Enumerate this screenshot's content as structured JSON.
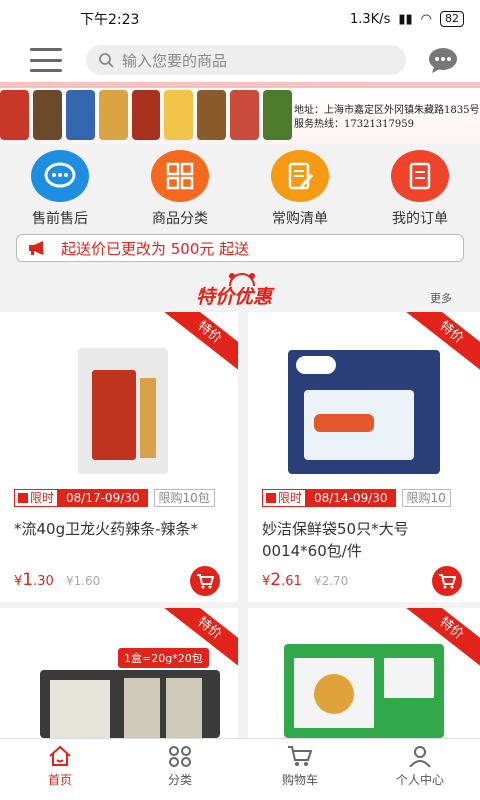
{
  "status": {
    "time": "下午2:23",
    "net": "1.3K/s",
    "battery": "82"
  },
  "header": {
    "search_placeholder": "输入您要的商品"
  },
  "banner": {
    "address_line": "地址：上海市嘉定区外冈镇朱藏路1835号",
    "hotline": "服务热线：17321317959"
  },
  "quick": [
    {
      "label": "售前售后",
      "color": "#1e8fe0"
    },
    {
      "label": "商品分类",
      "color": "#f56a1e"
    },
    {
      "label": "常购清单",
      "color": "#f59a12"
    },
    {
      "label": "我的订单",
      "color": "#f0442a"
    }
  ],
  "notice": {
    "text": "起送价已更改为  500元  起送"
  },
  "promo": {
    "title": "特价优惠",
    "more": "更多"
  },
  "products": [
    {
      "ribbon": "特价",
      "limit_label": "限时",
      "date": "08/17-09/30",
      "qty": "限购10包",
      "name": "*流40g卫龙火药辣条-辣条*",
      "currency": "¥",
      "price_int": "1",
      "price_dec": ".30",
      "old_price": "¥1.60"
    },
    {
      "ribbon": "特价",
      "limit_label": "限时",
      "date": "08/14-09/30",
      "qty": "限购10",
      "name": "妙洁保鲜袋50只*大号0014*60包/件",
      "currency": "¥",
      "price_int": "2",
      "price_dec": ".61",
      "old_price": "¥2.70"
    },
    {
      "ribbon": "特价",
      "tag": "1盒=20g*20包"
    },
    {
      "ribbon": "特价"
    }
  ],
  "tabs": [
    {
      "label": "首页",
      "icon": "home-icon"
    },
    {
      "label": "分类",
      "icon": "category-icon"
    },
    {
      "label": "购物车",
      "icon": "cart-icon"
    },
    {
      "label": "个人中心",
      "icon": "user-icon"
    }
  ],
  "colors": {
    "accent": "#e2231a"
  }
}
